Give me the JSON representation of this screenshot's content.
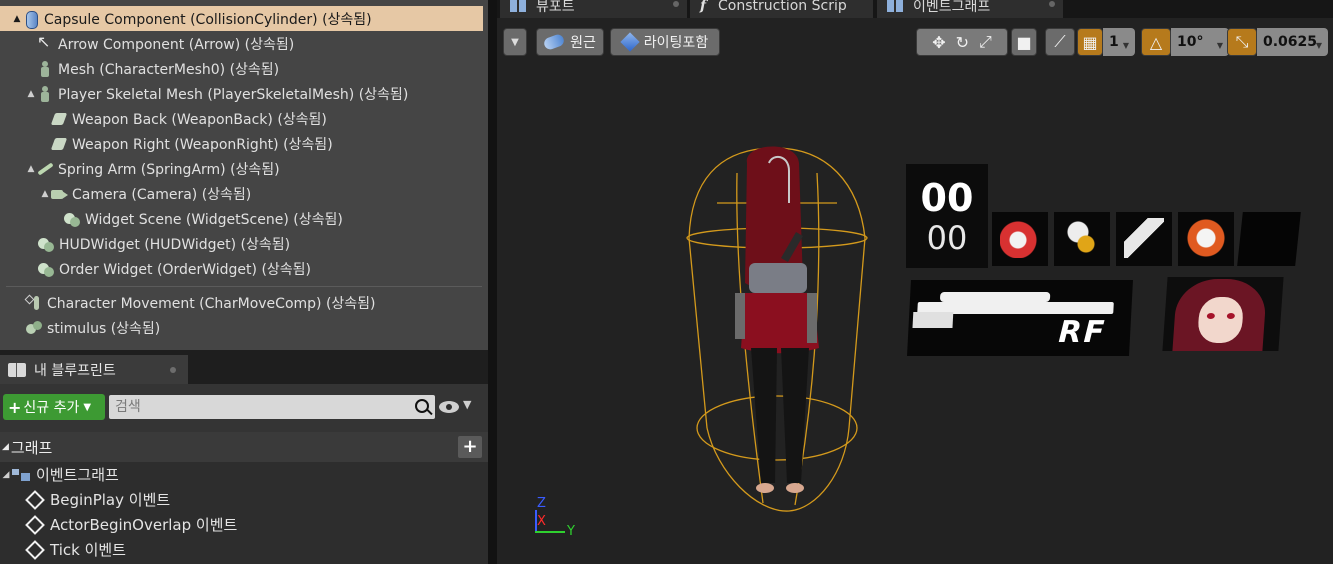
{
  "components": {
    "items": [
      {
        "label": "Capsule Component (CollisionCylinder) (상속됨)",
        "icon": "capsule-icon",
        "expand": "▲"
      },
      {
        "label": "Arrow Component (Arrow) (상속됨)",
        "icon": "arrow-icon",
        "expand": ""
      },
      {
        "label": "Mesh (CharacterMesh0) (상속됨)",
        "icon": "character-mesh-icon",
        "expand": ""
      },
      {
        "label": "Player Skeletal Mesh (PlayerSkeletalMesh) (상속됨)",
        "icon": "skeletal-mesh-icon",
        "expand": "▲"
      },
      {
        "label": "Weapon Back (WeaponBack) (상속됨)",
        "icon": "weapon-icon",
        "expand": ""
      },
      {
        "label": "Weapon Right (WeaponRight) (상속됨)",
        "icon": "weapon-icon",
        "expand": ""
      },
      {
        "label": "Spring Arm (SpringArm) (상속됨)",
        "icon": "spring-arm-icon",
        "expand": "▲"
      },
      {
        "label": "Camera (Camera) (상속됨)",
        "icon": "camera-icon",
        "expand": "▲"
      },
      {
        "label": "Widget Scene (WidgetScene) (상속됨)",
        "icon": "widget-icon",
        "expand": ""
      },
      {
        "label": "HUDWidget (HUDWidget) (상속됨)",
        "icon": "widget-icon",
        "expand": ""
      },
      {
        "label": "Order Widget (OrderWidget) (상속됨)",
        "icon": "widget-icon",
        "expand": ""
      },
      {
        "label": "Character Movement (CharMoveComp) (상속됨)",
        "icon": "movement-icon",
        "expand": ""
      },
      {
        "label": "stimulus (상속됨)",
        "icon": "stimulus-icon",
        "expand": ""
      }
    ]
  },
  "my_blueprint": {
    "tab_label": "내 블루프린트",
    "add_new_label": "신규 추가",
    "search_placeholder": "검색",
    "graph_section_label": "그래프",
    "event_graph_label": "이벤트그래프",
    "events": [
      "BeginPlay 이벤트",
      "ActorBeginOverlap 이벤트",
      "Tick 이벤트"
    ]
  },
  "viewport": {
    "tabs": [
      "뷰포트",
      "Construction Scrip",
      "이벤트그래프"
    ],
    "perspective_label": "원근",
    "lit_label": "라이팅포함",
    "grid_snap_value": "1",
    "rotation_snap_value": "10°",
    "scale_snap_value": "0.0625",
    "accent_color": "#b67a1c",
    "hud": {
      "timer_top": "00",
      "timer_bottom": "00",
      "weapon_code": "RF"
    },
    "axis": {
      "z": "Z",
      "x": "X",
      "y": "Y"
    }
  }
}
